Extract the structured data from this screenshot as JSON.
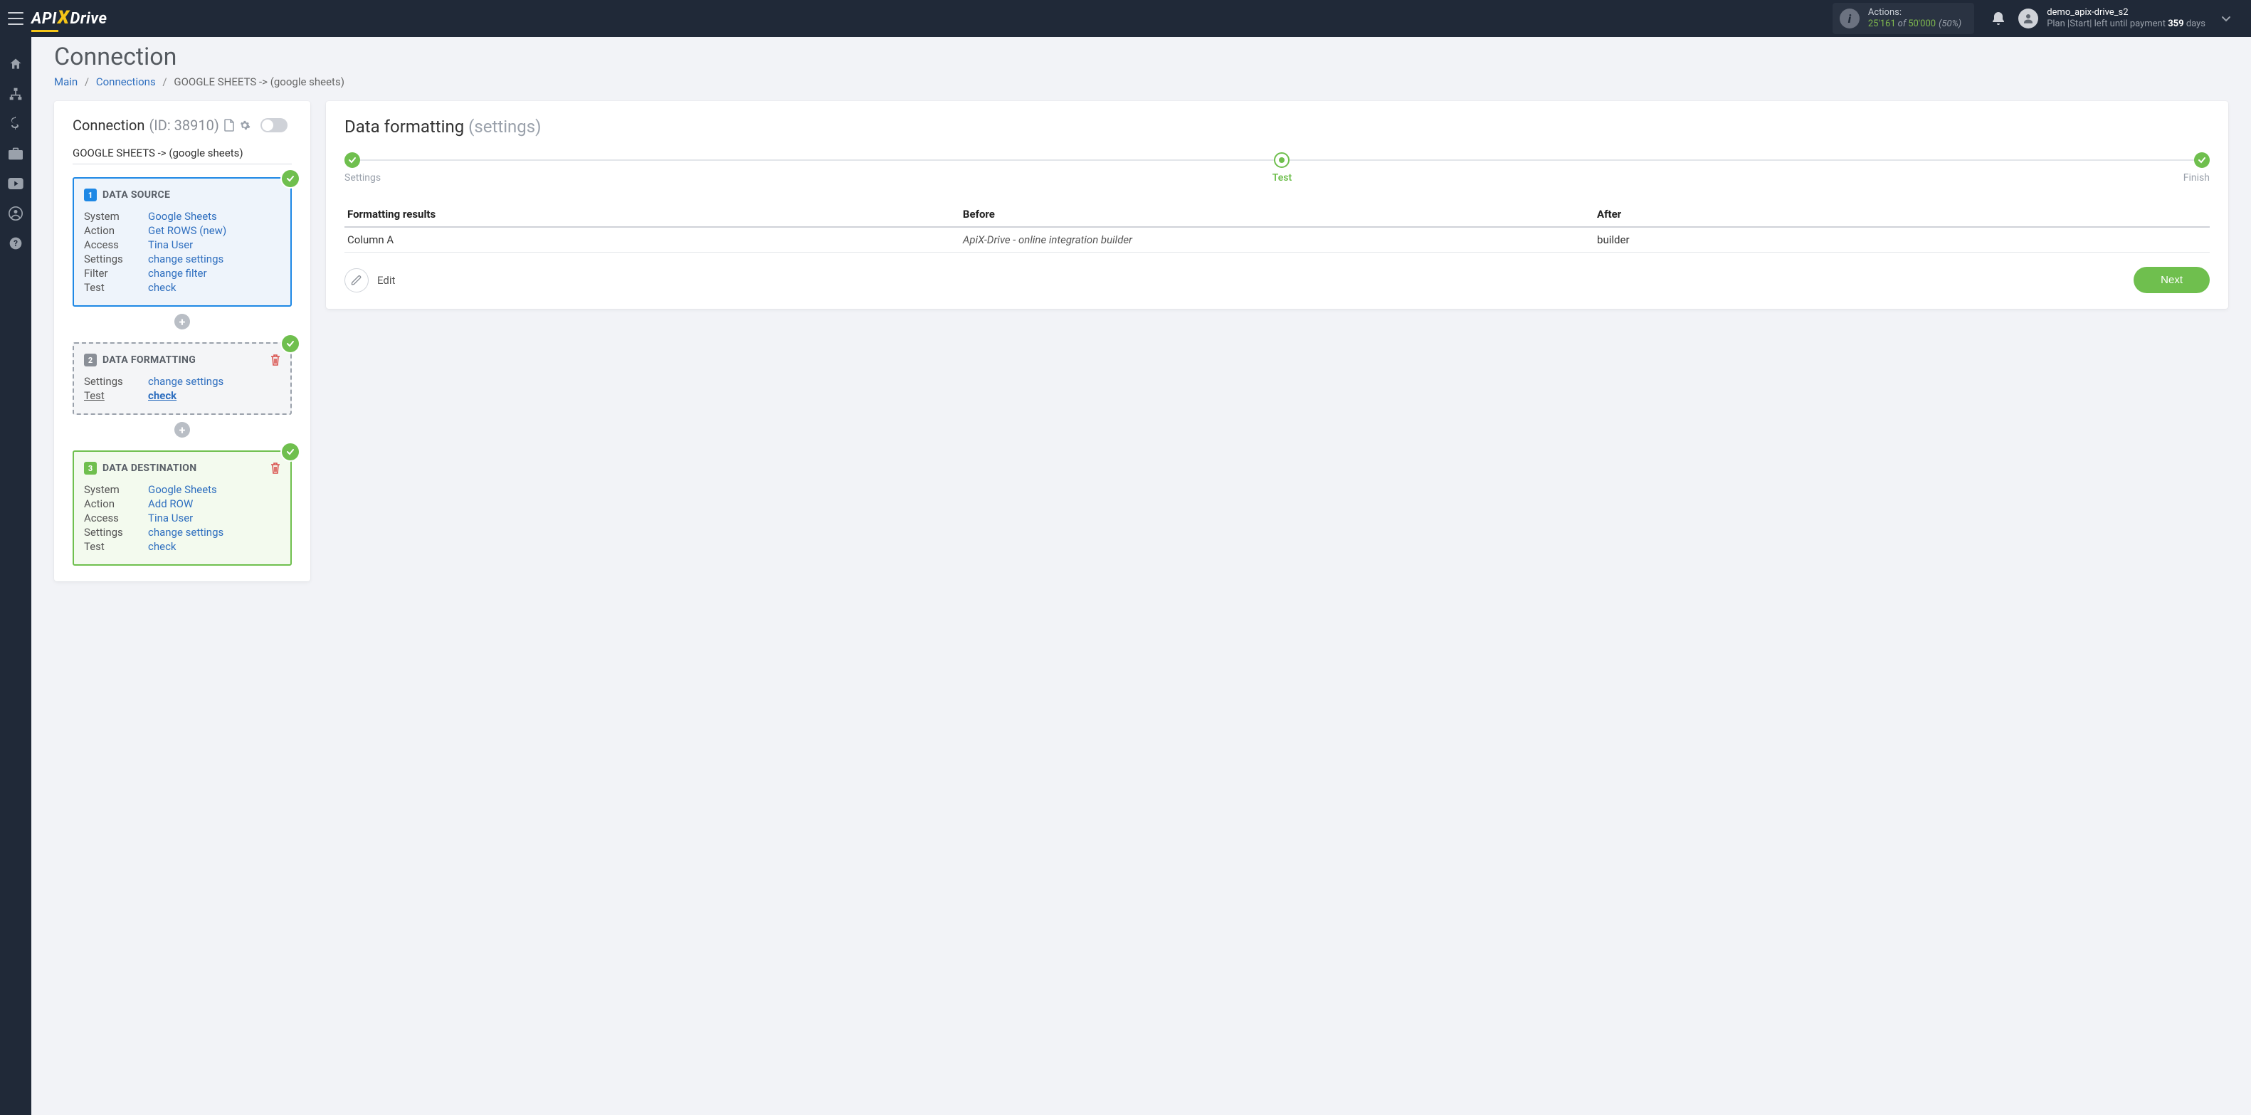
{
  "header": {
    "actions_label": "Actions:",
    "actions_used": "25'161",
    "actions_of": "of",
    "actions_total": "50'000",
    "actions_pct": "(50%)",
    "username": "demo_apix-drive_s2",
    "plan_prefix": "Plan |Start| left until payment ",
    "plan_days": "359",
    "plan_suffix": " days"
  },
  "page": {
    "title": "Connection",
    "crumb_main": "Main",
    "crumb_connections": "Connections",
    "crumb_current": "GOOGLE SHEETS -> (google sheets)"
  },
  "left": {
    "title": "Connection ",
    "title_sub": "(ID: 38910)",
    "subtitle": "GOOGLE SHEETS -> (google sheets)",
    "source": {
      "title": "DATA SOURCE",
      "rows": [
        {
          "k": "System",
          "v": "Google Sheets"
        },
        {
          "k": "Action",
          "v": "Get ROWS (new)"
        },
        {
          "k": "Access",
          "v": "Tina User"
        },
        {
          "k": "Settings",
          "v": "change settings"
        },
        {
          "k": "Filter",
          "v": "change filter"
        },
        {
          "k": "Test",
          "v": "check"
        }
      ]
    },
    "formatting": {
      "title": "DATA FORMATTING",
      "rows": [
        {
          "k": "Settings",
          "v": "change settings"
        },
        {
          "k": "Test",
          "v": "check",
          "active": true
        }
      ]
    },
    "destination": {
      "title": "DATA DESTINATION",
      "rows": [
        {
          "k": "System",
          "v": "Google Sheets"
        },
        {
          "k": "Action",
          "v": "Add ROW"
        },
        {
          "k": "Access",
          "v": "Tina User"
        },
        {
          "k": "Settings",
          "v": "change settings"
        },
        {
          "k": "Test",
          "v": "check"
        }
      ]
    }
  },
  "right": {
    "title": "Data formatting ",
    "title_sub": "(settings)",
    "steps": {
      "s1": "Settings",
      "s2": "Test",
      "s3": "Finish"
    },
    "table": {
      "h1": "Formatting results",
      "h2": "Before",
      "h3": "After",
      "r1c1": "Column A",
      "r1c2": "ApiX-Drive - online integration builder",
      "r1c3": "builder"
    },
    "edit": "Edit",
    "next": "Next"
  }
}
